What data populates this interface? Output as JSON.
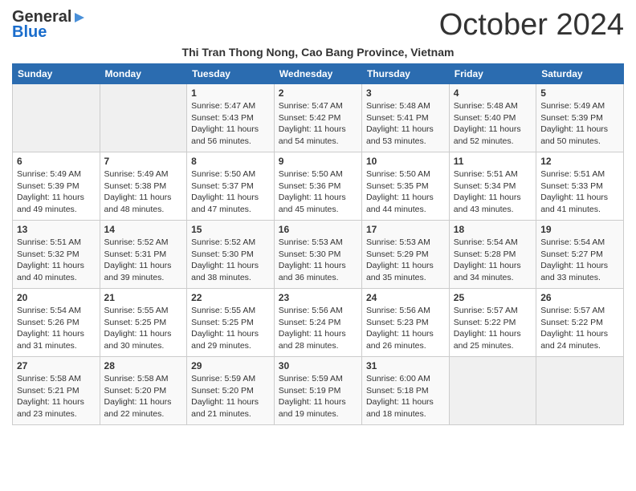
{
  "logo": {
    "general": "General",
    "blue": "Blue"
  },
  "title": "October 2024",
  "subtitle": "Thi Tran Thong Nong, Cao Bang Province, Vietnam",
  "headers": [
    "Sunday",
    "Monday",
    "Tuesday",
    "Wednesday",
    "Thursday",
    "Friday",
    "Saturday"
  ],
  "weeks": [
    [
      {
        "day": "",
        "empty": true
      },
      {
        "day": "",
        "empty": true
      },
      {
        "day": "1",
        "sunrise": "Sunrise: 5:47 AM",
        "sunset": "Sunset: 5:43 PM",
        "daylight": "Daylight: 11 hours and 56 minutes."
      },
      {
        "day": "2",
        "sunrise": "Sunrise: 5:47 AM",
        "sunset": "Sunset: 5:42 PM",
        "daylight": "Daylight: 11 hours and 54 minutes."
      },
      {
        "day": "3",
        "sunrise": "Sunrise: 5:48 AM",
        "sunset": "Sunset: 5:41 PM",
        "daylight": "Daylight: 11 hours and 53 minutes."
      },
      {
        "day": "4",
        "sunrise": "Sunrise: 5:48 AM",
        "sunset": "Sunset: 5:40 PM",
        "daylight": "Daylight: 11 hours and 52 minutes."
      },
      {
        "day": "5",
        "sunrise": "Sunrise: 5:49 AM",
        "sunset": "Sunset: 5:39 PM",
        "daylight": "Daylight: 11 hours and 50 minutes."
      }
    ],
    [
      {
        "day": "6",
        "sunrise": "Sunrise: 5:49 AM",
        "sunset": "Sunset: 5:39 PM",
        "daylight": "Daylight: 11 hours and 49 minutes."
      },
      {
        "day": "7",
        "sunrise": "Sunrise: 5:49 AM",
        "sunset": "Sunset: 5:38 PM",
        "daylight": "Daylight: 11 hours and 48 minutes."
      },
      {
        "day": "8",
        "sunrise": "Sunrise: 5:50 AM",
        "sunset": "Sunset: 5:37 PM",
        "daylight": "Daylight: 11 hours and 47 minutes."
      },
      {
        "day": "9",
        "sunrise": "Sunrise: 5:50 AM",
        "sunset": "Sunset: 5:36 PM",
        "daylight": "Daylight: 11 hours and 45 minutes."
      },
      {
        "day": "10",
        "sunrise": "Sunrise: 5:50 AM",
        "sunset": "Sunset: 5:35 PM",
        "daylight": "Daylight: 11 hours and 44 minutes."
      },
      {
        "day": "11",
        "sunrise": "Sunrise: 5:51 AM",
        "sunset": "Sunset: 5:34 PM",
        "daylight": "Daylight: 11 hours and 43 minutes."
      },
      {
        "day": "12",
        "sunrise": "Sunrise: 5:51 AM",
        "sunset": "Sunset: 5:33 PM",
        "daylight": "Daylight: 11 hours and 41 minutes."
      }
    ],
    [
      {
        "day": "13",
        "sunrise": "Sunrise: 5:51 AM",
        "sunset": "Sunset: 5:32 PM",
        "daylight": "Daylight: 11 hours and 40 minutes."
      },
      {
        "day": "14",
        "sunrise": "Sunrise: 5:52 AM",
        "sunset": "Sunset: 5:31 PM",
        "daylight": "Daylight: 11 hours and 39 minutes."
      },
      {
        "day": "15",
        "sunrise": "Sunrise: 5:52 AM",
        "sunset": "Sunset: 5:30 PM",
        "daylight": "Daylight: 11 hours and 38 minutes."
      },
      {
        "day": "16",
        "sunrise": "Sunrise: 5:53 AM",
        "sunset": "Sunset: 5:30 PM",
        "daylight": "Daylight: 11 hours and 36 minutes."
      },
      {
        "day": "17",
        "sunrise": "Sunrise: 5:53 AM",
        "sunset": "Sunset: 5:29 PM",
        "daylight": "Daylight: 11 hours and 35 minutes."
      },
      {
        "day": "18",
        "sunrise": "Sunrise: 5:54 AM",
        "sunset": "Sunset: 5:28 PM",
        "daylight": "Daylight: 11 hours and 34 minutes."
      },
      {
        "day": "19",
        "sunrise": "Sunrise: 5:54 AM",
        "sunset": "Sunset: 5:27 PM",
        "daylight": "Daylight: 11 hours and 33 minutes."
      }
    ],
    [
      {
        "day": "20",
        "sunrise": "Sunrise: 5:54 AM",
        "sunset": "Sunset: 5:26 PM",
        "daylight": "Daylight: 11 hours and 31 minutes."
      },
      {
        "day": "21",
        "sunrise": "Sunrise: 5:55 AM",
        "sunset": "Sunset: 5:25 PM",
        "daylight": "Daylight: 11 hours and 30 minutes."
      },
      {
        "day": "22",
        "sunrise": "Sunrise: 5:55 AM",
        "sunset": "Sunset: 5:25 PM",
        "daylight": "Daylight: 11 hours and 29 minutes."
      },
      {
        "day": "23",
        "sunrise": "Sunrise: 5:56 AM",
        "sunset": "Sunset: 5:24 PM",
        "daylight": "Daylight: 11 hours and 28 minutes."
      },
      {
        "day": "24",
        "sunrise": "Sunrise: 5:56 AM",
        "sunset": "Sunset: 5:23 PM",
        "daylight": "Daylight: 11 hours and 26 minutes."
      },
      {
        "day": "25",
        "sunrise": "Sunrise: 5:57 AM",
        "sunset": "Sunset: 5:22 PM",
        "daylight": "Daylight: 11 hours and 25 minutes."
      },
      {
        "day": "26",
        "sunrise": "Sunrise: 5:57 AM",
        "sunset": "Sunset: 5:22 PM",
        "daylight": "Daylight: 11 hours and 24 minutes."
      }
    ],
    [
      {
        "day": "27",
        "sunrise": "Sunrise: 5:58 AM",
        "sunset": "Sunset: 5:21 PM",
        "daylight": "Daylight: 11 hours and 23 minutes."
      },
      {
        "day": "28",
        "sunrise": "Sunrise: 5:58 AM",
        "sunset": "Sunset: 5:20 PM",
        "daylight": "Daylight: 11 hours and 22 minutes."
      },
      {
        "day": "29",
        "sunrise": "Sunrise: 5:59 AM",
        "sunset": "Sunset: 5:20 PM",
        "daylight": "Daylight: 11 hours and 21 minutes."
      },
      {
        "day": "30",
        "sunrise": "Sunrise: 5:59 AM",
        "sunset": "Sunset: 5:19 PM",
        "daylight": "Daylight: 11 hours and 19 minutes."
      },
      {
        "day": "31",
        "sunrise": "Sunrise: 6:00 AM",
        "sunset": "Sunset: 5:18 PM",
        "daylight": "Daylight: 11 hours and 18 minutes."
      },
      {
        "day": "",
        "empty": true
      },
      {
        "day": "",
        "empty": true
      }
    ]
  ]
}
